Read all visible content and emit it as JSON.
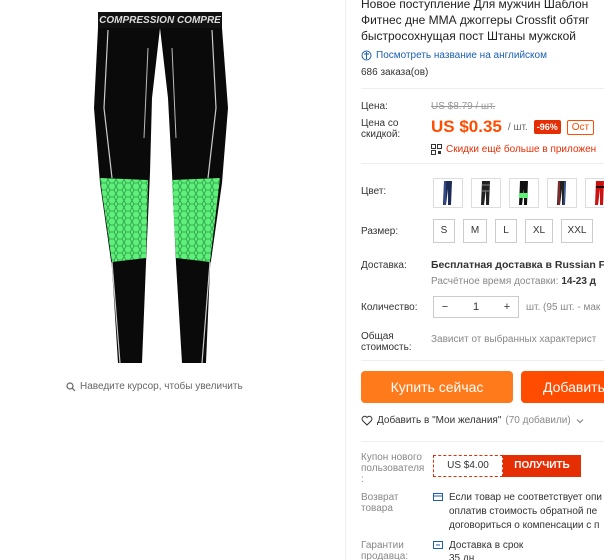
{
  "product": {
    "brand_print": "COMPRESSION COMPRE",
    "zoom_hint": "Наведите курсор, чтобы увеличить",
    "title": "Новое поступление Для мужчин Шаблон\nФитнес дне ММА джоггеры Crossfit обтяг\nбыстросохнущая пост Штаны мужской",
    "translate_link": "Посмотреть название на английском",
    "orders": "686 заказа(ов)"
  },
  "price": {
    "label": "Цена:",
    "old": "US $8.79 / шт.",
    "discount_label": "Цена со\nскидкой:",
    "new": "US $0.35",
    "per_unit": "/ шт.",
    "discount_pct": "-96%",
    "tag": "Ост",
    "app_discount": "Скидки ещё больше в приложен"
  },
  "color": {
    "label": "Цвет:",
    "swatches": [
      "navy-stripe",
      "grey-black",
      "black-green",
      "blue-red",
      "red-black"
    ]
  },
  "size": {
    "label": "Размер:",
    "options": [
      "S",
      "M",
      "L",
      "XL",
      "XXL"
    ]
  },
  "shipping": {
    "label": "Доставка:",
    "line1_bold": "Бесплатная доставка в Russian Fe",
    "line2_grey": "Расчётное время доставки:",
    "line2_bold": "14-23 д"
  },
  "quantity": {
    "label": "Количество:",
    "minus": "−",
    "value": "1",
    "plus": "+",
    "available": "шт. (95 шт. - мак"
  },
  "total": {
    "label": "Общая\nстоимость:",
    "value": "Зависит от выбранных характерист"
  },
  "actions": {
    "buy_now": "Купить сейчас",
    "add_to_cart": "Добавить"
  },
  "wishlist": {
    "text": "Добавить в \"Мои желания\"",
    "count": "(70 добавили)"
  },
  "coupon": {
    "label": "Купон нового\nпользователя\n:",
    "value": "US $4.00",
    "button": "ПОЛУЧИТЬ"
  },
  "returns": {
    "label": "Возврат\nтовара",
    "text": "Если товар не соответствует опи\nоплатив стоимость обратной пе\nдоговориться о компенсации с п"
  },
  "guarantee": {
    "label": "Гарантии\nпродавца:",
    "text": "Доставка в срок\n35 дн"
  },
  "colors": {
    "accent_orange": "#ff7a1a",
    "accent_red": "#ff4c00",
    "discount_red": "#e62e04",
    "link_blue": "#1a5fb4",
    "pants_green": "#5ef07a"
  }
}
